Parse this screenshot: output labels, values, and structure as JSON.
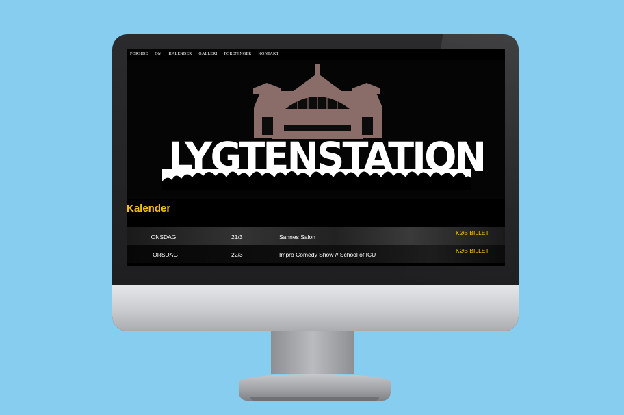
{
  "nav": {
    "items": [
      "FORSIDE",
      "OM",
      "KALENDER",
      "GALLERI",
      "FORENINGER",
      "KONTAKT"
    ]
  },
  "banner": {
    "logo_text": "LYGTENSTATION"
  },
  "calendar": {
    "heading": "Kalender",
    "events": [
      {
        "day": "ONSDAG",
        "date": "21/3",
        "title": "Sannes Salon",
        "buy_label": "KØB BILLET"
      },
      {
        "day": "TORSDAG",
        "date": "22/3",
        "title": "Impro Comedy Show // School of ICU",
        "buy_label": "KØB BILLET"
      }
    ]
  },
  "colors": {
    "background": "#86cdef",
    "accent": "#f4c300",
    "screen": "#000000",
    "building": "#8a6c69"
  }
}
